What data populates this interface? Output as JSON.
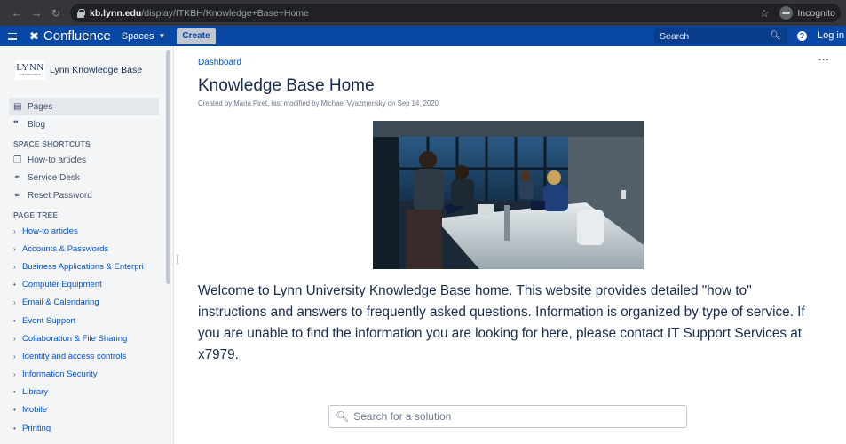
{
  "browser": {
    "url_host": "kb.lynn.edu",
    "url_path": "/display/ITKBH/Knowledge+Base+Home",
    "incognito_label": "Incognito"
  },
  "header": {
    "logo_text": "Confluence",
    "spaces_label": "Spaces",
    "create_label": "Create",
    "search_placeholder": "Search",
    "login_label": "Log in",
    "colors": {
      "brand": "#0747a6"
    }
  },
  "sidebar": {
    "space_logo_line1": "LYNN",
    "space_logo_line2": "UNIVERSITY",
    "space_name": "Lynn Knowledge Base",
    "nav": [
      {
        "label": "Pages",
        "icon": "page-icon"
      },
      {
        "label": "Blog",
        "icon": "quote-icon"
      }
    ],
    "shortcuts_heading": "SPACE SHORTCUTS",
    "shortcuts": [
      {
        "label": "How-to articles",
        "icon": "copy-icon"
      },
      {
        "label": "Service Desk",
        "icon": "link-icon"
      },
      {
        "label": "Reset Password",
        "icon": "link-icon"
      }
    ],
    "tree_heading": "PAGE TREE",
    "tree": [
      {
        "label": "How-to articles",
        "mark": "›"
      },
      {
        "label": "Accounts & Passwords",
        "mark": "›"
      },
      {
        "label": "Business Applications & Enterpri",
        "mark": "›"
      },
      {
        "label": "Computer Equipment",
        "mark": "•"
      },
      {
        "label": "Email & Calendaring",
        "mark": "›"
      },
      {
        "label": "Event Support",
        "mark": "•"
      },
      {
        "label": "Collaboration & File Sharing",
        "mark": "›"
      },
      {
        "label": "Identity and access controls",
        "mark": "›"
      },
      {
        "label": "Information Security",
        "mark": "›"
      },
      {
        "label": "Library",
        "mark": "•"
      },
      {
        "label": "Mobile",
        "mark": "•"
      },
      {
        "label": "Printing",
        "mark": "•"
      }
    ]
  },
  "main": {
    "breadcrumb": "Dashboard",
    "title": "Knowledge Base Home",
    "byline": "Created by Maria Piret, last modified by Michael Vyazmensky on Sep 14, 2020",
    "welcome_text": "Welcome to Lynn University Knowledge Base home. This website provides detailed \"how to\" instructions and answers to frequently asked questions. Information is organized by type of service.  If you are unable to find the information you are looking for here, please contact IT Support Services at x7979.",
    "solution_search_placeholder": "Search for a solution"
  }
}
